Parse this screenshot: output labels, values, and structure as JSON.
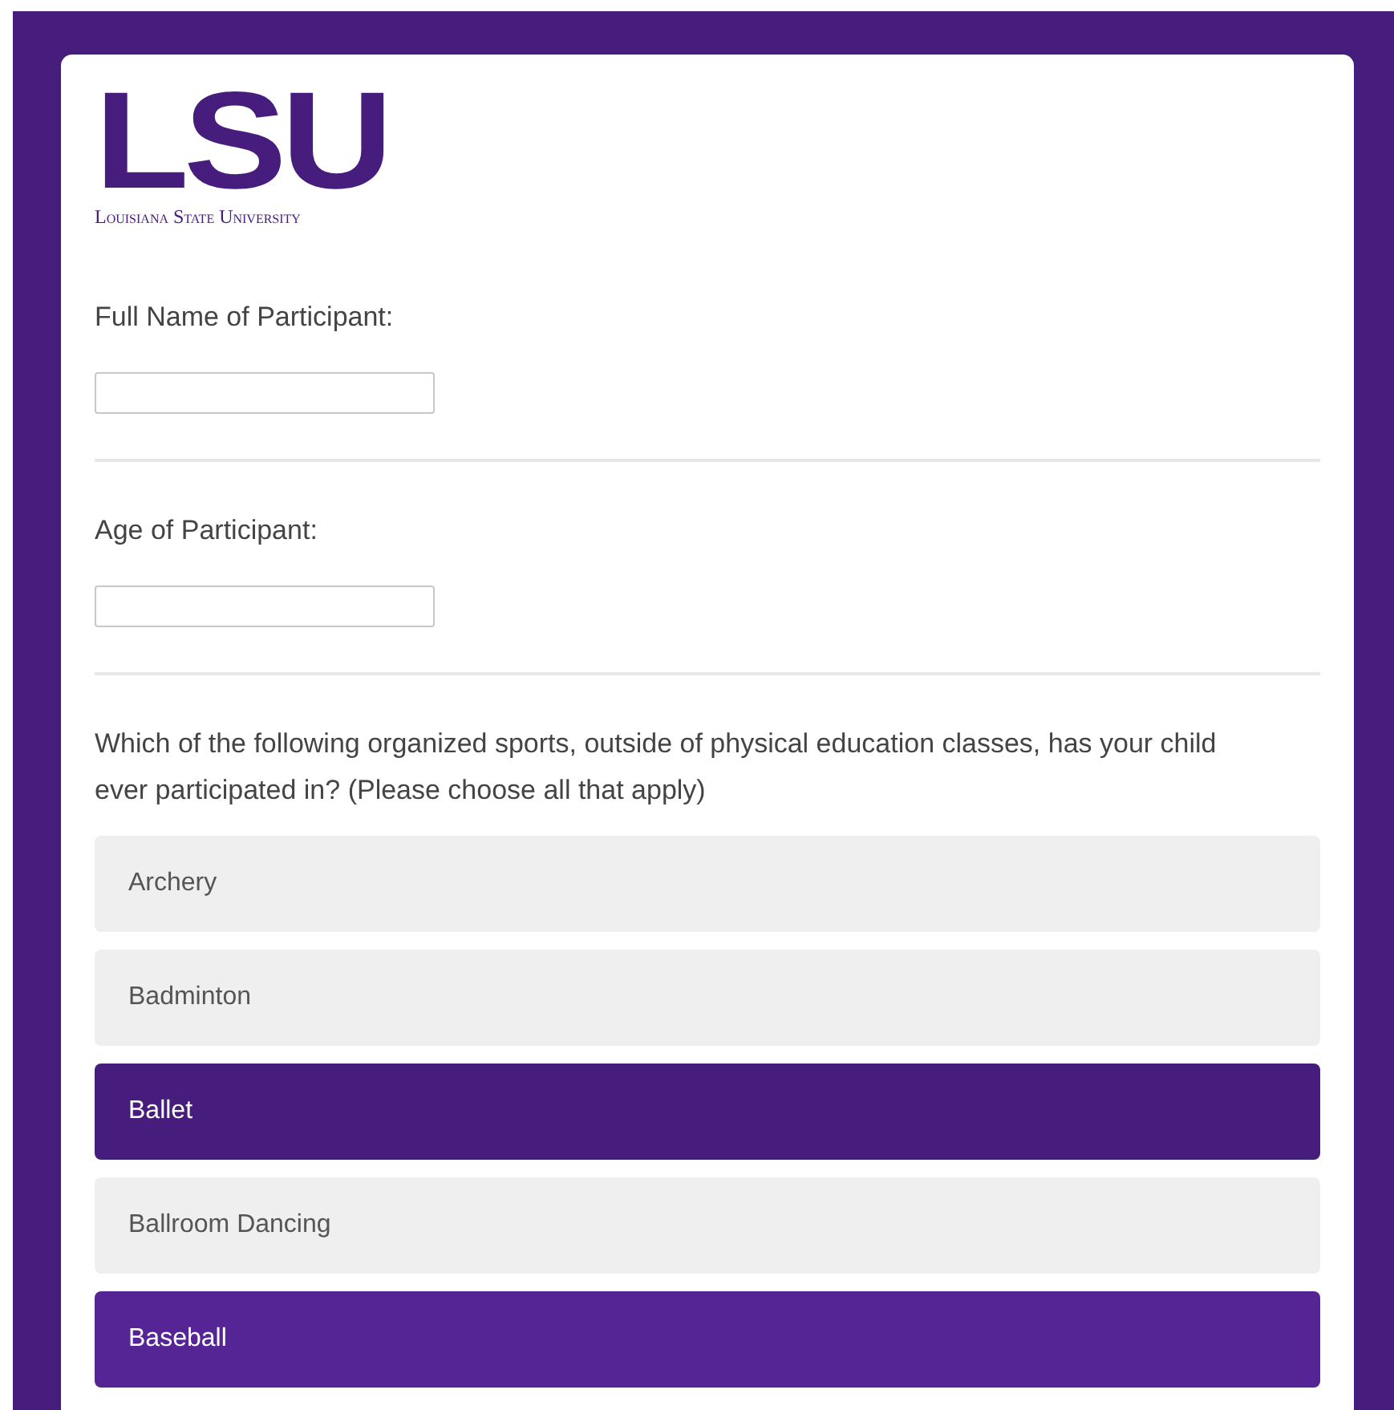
{
  "logo": {
    "mark": "LSU",
    "wordmark": "Louisiana State University"
  },
  "questions": [
    {
      "kind": "text",
      "label": "Full Name of Participant:"
    },
    {
      "kind": "text",
      "label": "Age of Participant:"
    },
    {
      "kind": "multi",
      "label": "Which of the following organized sports, outside of physical education classes, has your child ever participated in? (Please choose all that apply)",
      "options": [
        {
          "label": "Archery",
          "selected": false,
          "hovered": false
        },
        {
          "label": "Badminton",
          "selected": false,
          "hovered": false
        },
        {
          "label": "Ballet",
          "selected": true,
          "hovered": false
        },
        {
          "label": "Ballroom Dancing",
          "selected": false,
          "hovered": false
        },
        {
          "label": "Baseball",
          "selected": true,
          "hovered": true
        }
      ]
    }
  ]
}
